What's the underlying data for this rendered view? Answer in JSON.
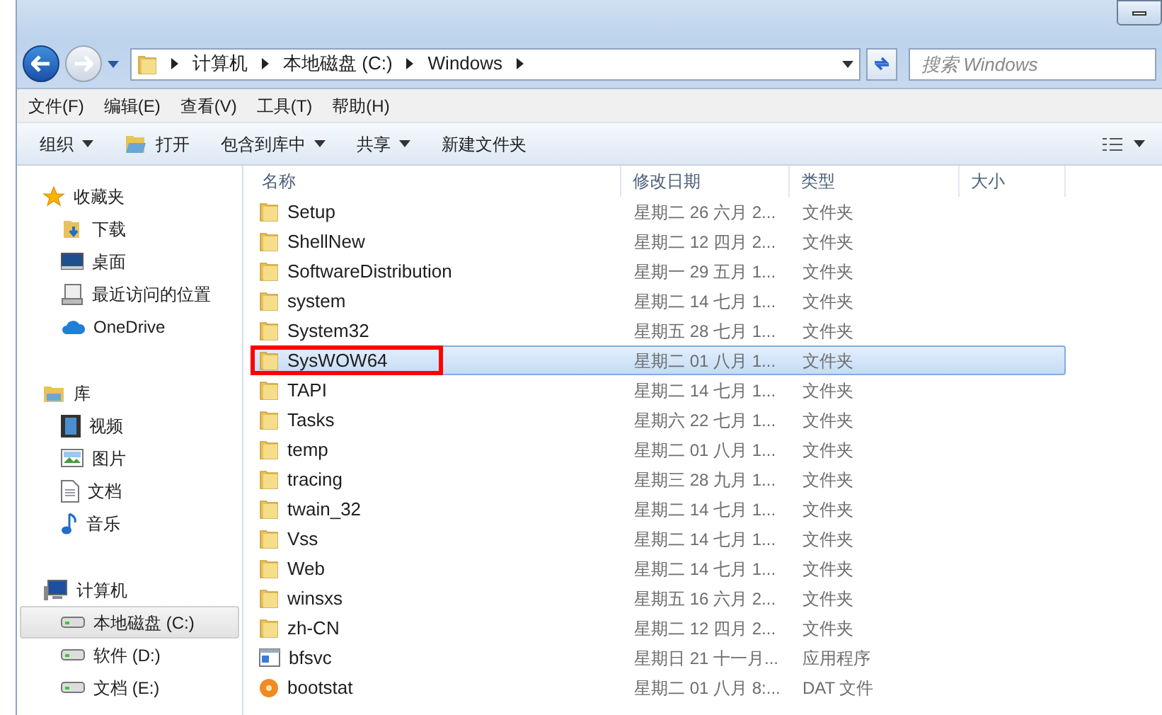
{
  "address_bar": {
    "segments": [
      "计算机",
      "本地磁盘 (C:)",
      "Windows"
    ]
  },
  "search": {
    "placeholder": "搜索 Windows"
  },
  "menu": [
    "文件(F)",
    "编辑(E)",
    "查看(V)",
    "工具(T)",
    "帮助(H)"
  ],
  "toolbar": [
    {
      "label": "组织",
      "kind": "dropdown"
    },
    {
      "label": "打开",
      "kind": "open"
    },
    {
      "label": "包含到库中",
      "kind": "dropdown"
    },
    {
      "label": "共享",
      "kind": "dropdown"
    },
    {
      "label": "新建文件夹",
      "kind": "plain"
    }
  ],
  "sidebar": {
    "groups": [
      {
        "label": "收藏夹",
        "kind": "favorites",
        "children": [
          {
            "label": "下载",
            "kind": "download",
            "selected": false
          },
          {
            "label": "桌面",
            "kind": "desktop",
            "selected": false
          },
          {
            "label": "最近访问的位置",
            "kind": "recent",
            "selected": false
          },
          {
            "label": "OneDrive",
            "kind": "cloud",
            "selected": false
          }
        ]
      },
      {
        "label": "库",
        "kind": "library",
        "children": [
          {
            "label": "视频",
            "kind": "video",
            "selected": false
          },
          {
            "label": "图片",
            "kind": "picture",
            "selected": false
          },
          {
            "label": "文档",
            "kind": "document",
            "selected": false
          },
          {
            "label": "音乐",
            "kind": "music",
            "selected": false
          }
        ]
      },
      {
        "label": "计算机",
        "kind": "computer",
        "children": [
          {
            "label": "本地磁盘 (C:)",
            "kind": "drive",
            "selected": true
          },
          {
            "label": "软件 (D:)",
            "kind": "drive",
            "selected": false
          },
          {
            "label": "文档 (E:)",
            "kind": "drive",
            "selected": false
          }
        ]
      }
    ]
  },
  "table": {
    "columns": [
      "名称",
      "修改日期",
      "类型",
      "大小"
    ],
    "rows": [
      {
        "name": "Setup",
        "date": "星期二 26 六月 2...",
        "type": "文件夹",
        "kind": "folder",
        "selected": false,
        "annotated": false
      },
      {
        "name": "ShellNew",
        "date": "星期二 12 四月 2...",
        "type": "文件夹",
        "kind": "folder",
        "selected": false,
        "annotated": false
      },
      {
        "name": "SoftwareDistribution",
        "date": "星期一 29 五月 1...",
        "type": "文件夹",
        "kind": "folder",
        "selected": false,
        "annotated": false
      },
      {
        "name": "system",
        "date": "星期二 14 七月 1...",
        "type": "文件夹",
        "kind": "folder",
        "selected": false,
        "annotated": false
      },
      {
        "name": "System32",
        "date": "星期五 28 七月 1...",
        "type": "文件夹",
        "kind": "folder",
        "selected": false,
        "annotated": false
      },
      {
        "name": "SysWOW64",
        "date": "星期二 01 八月 1...",
        "type": "文件夹",
        "kind": "folder",
        "selected": true,
        "annotated": true
      },
      {
        "name": "TAPI",
        "date": "星期二 14 七月 1...",
        "type": "文件夹",
        "kind": "folder",
        "selected": false,
        "annotated": false
      },
      {
        "name": "Tasks",
        "date": "星期六 22 七月 1...",
        "type": "文件夹",
        "kind": "folder",
        "selected": false,
        "annotated": false
      },
      {
        "name": "temp",
        "date": "星期二 01 八月 1...",
        "type": "文件夹",
        "kind": "folder",
        "selected": false,
        "annotated": false
      },
      {
        "name": "tracing",
        "date": "星期三 28 九月 1...",
        "type": "文件夹",
        "kind": "folder",
        "selected": false,
        "annotated": false
      },
      {
        "name": "twain_32",
        "date": "星期二 14 七月 1...",
        "type": "文件夹",
        "kind": "folder",
        "selected": false,
        "annotated": false
      },
      {
        "name": "Vss",
        "date": "星期二 14 七月 1...",
        "type": "文件夹",
        "kind": "folder",
        "selected": false,
        "annotated": false
      },
      {
        "name": "Web",
        "date": "星期二 14 七月 1...",
        "type": "文件夹",
        "kind": "folder",
        "selected": false,
        "annotated": false
      },
      {
        "name": "winsxs",
        "date": "星期五 16 六月 2...",
        "type": "文件夹",
        "kind": "folder",
        "selected": false,
        "annotated": false
      },
      {
        "name": "zh-CN",
        "date": "星期二 12 四月 2...",
        "type": "文件夹",
        "kind": "folder",
        "selected": false,
        "annotated": false
      },
      {
        "name": "bfsvc",
        "date": "星期日 21 十一月...",
        "type": "应用程序",
        "kind": "app",
        "selected": false,
        "annotated": false
      },
      {
        "name": "bootstat",
        "date": "星期二 01 八月 8:...",
        "type": "DAT 文件",
        "kind": "dat",
        "selected": false,
        "annotated": false
      }
    ]
  }
}
